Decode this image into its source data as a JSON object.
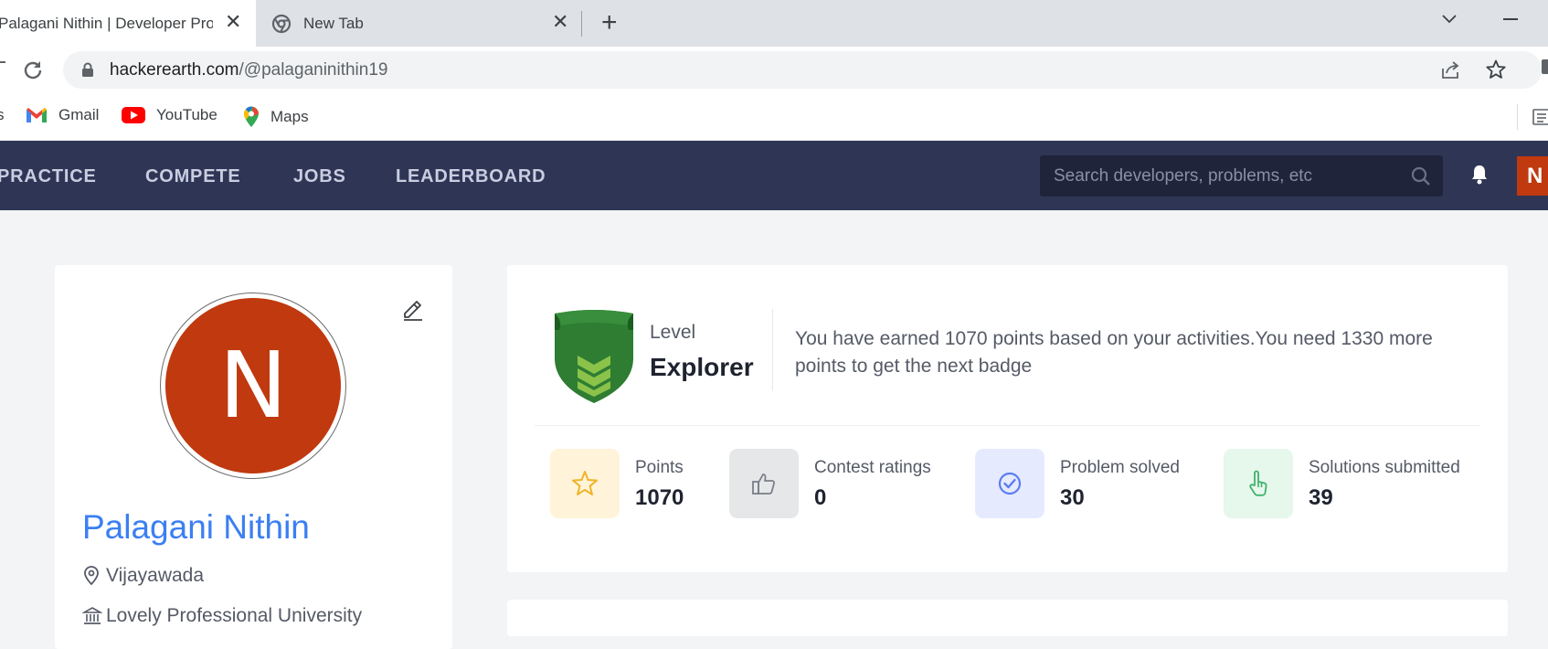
{
  "browser": {
    "tabs": [
      {
        "title": "Palagani Nithin | Developer Profile",
        "active": true
      },
      {
        "title": "New Tab",
        "active": false
      }
    ],
    "url_host": "hackerearth.com",
    "url_path": "/@palaganinithin19",
    "bookmarks": [
      {
        "label": "s",
        "icon": "apps-icon"
      },
      {
        "label": "Gmail",
        "icon": "gmail-icon"
      },
      {
        "label": "YouTube",
        "icon": "youtube-icon"
      },
      {
        "label": "Maps",
        "icon": "maps-icon"
      }
    ]
  },
  "navbar": {
    "items": [
      "PRACTICE",
      "COMPETE",
      "JOBS",
      "LEADERBOARD"
    ],
    "search_placeholder": "Search developers, problems, etc",
    "avatar_initial": "N",
    "accent": "#c0390f",
    "background": "#2f3555"
  },
  "profile": {
    "avatar_initial": "N",
    "name": "Palagani Nithin",
    "location": "Vijayawada",
    "university": "Lovely Professional University",
    "name_color": "#3b7ff2"
  },
  "level": {
    "label": "Level",
    "name": "Explorer",
    "message": "You have earned 1070 points based on your activities.You need 1330 more points to get the next badge",
    "badge_color": "#2e7d32"
  },
  "stats": [
    {
      "label": "Points",
      "value": "1070",
      "icon": "star-icon"
    },
    {
      "label": "Contest ratings",
      "value": "0",
      "icon": "thumbs-up-icon"
    },
    {
      "label": "Problem solved",
      "value": "30",
      "icon": "check-circle-icon"
    },
    {
      "label": "Solutions submitted",
      "value": "39",
      "icon": "pointer-hand-icon"
    }
  ]
}
